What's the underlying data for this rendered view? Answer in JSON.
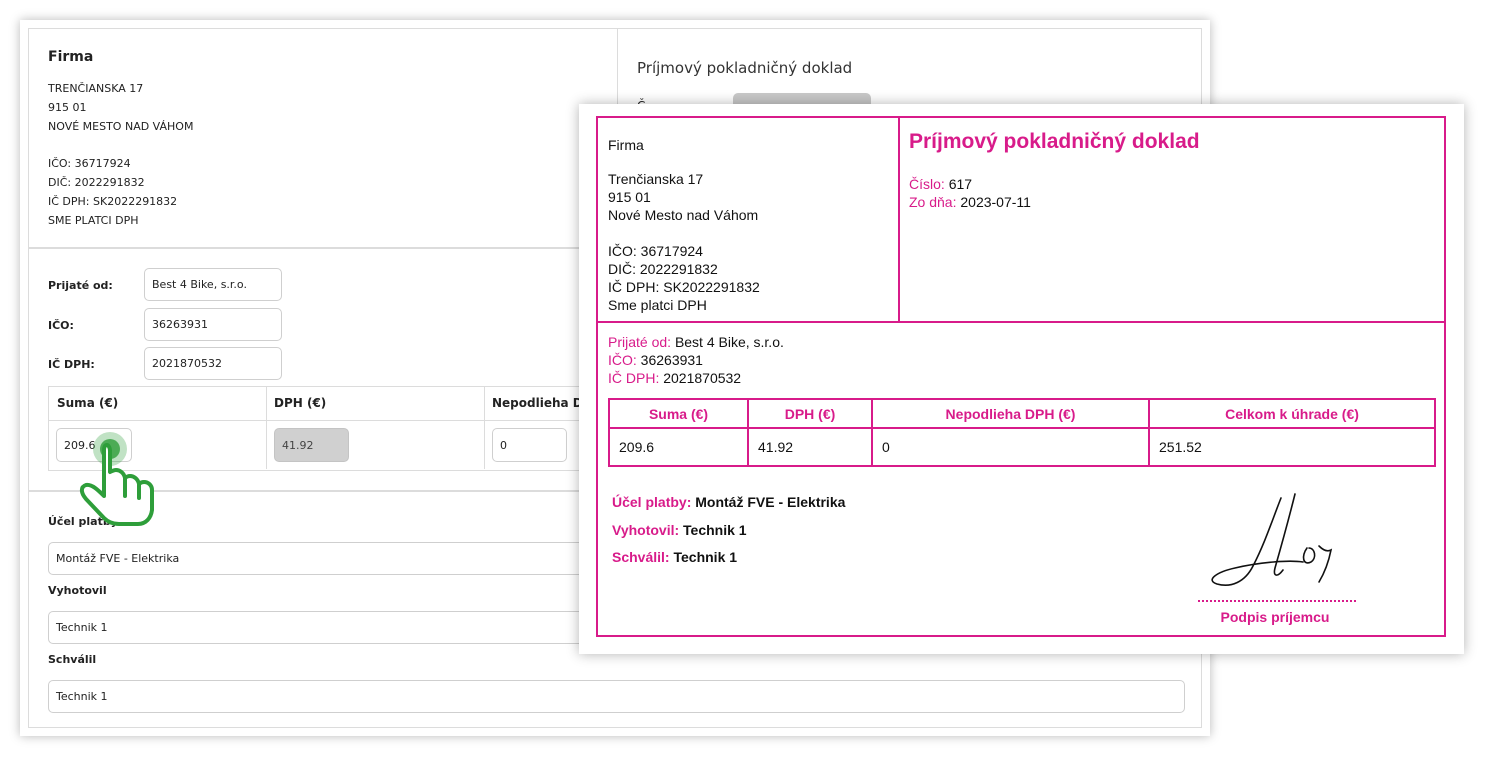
{
  "form": {
    "company": {
      "name": "Firma",
      "street": "TRENČIANSKA 17",
      "zip": "915 01",
      "city": "NOVÉ MESTO NAD VÁHOM",
      "ico": "IČO: 36717924",
      "dic": "DIČ: 2022291832",
      "icdph": "IČ DPH: SK2022291832",
      "vat_status": "SME PLATCI DPH"
    },
    "document_type": "Príjmový pokladničný doklad",
    "number_label_partial": "Č",
    "received_from": {
      "label": "Prijaté od:",
      "value": "Best 4 Bike, s.r.o."
    },
    "ico": {
      "label": "IČO:",
      "value": "36263931"
    },
    "icdph": {
      "label": "IČ DPH:",
      "value": "2021870532"
    },
    "amounts": {
      "sum_label": "Suma (€)",
      "vat_label": "DPH (€)",
      "exempt_label": "Nepodlieha D",
      "sum_value": "209.6",
      "vat_value": "41.92",
      "exempt_value": "0"
    },
    "purpose": {
      "label": "Účel platby",
      "value": "Montáž FVE - Elektrika"
    },
    "prepared_by": {
      "label": "Vyhotovil",
      "value": "Technik 1"
    },
    "approved_by": {
      "label": "Schválil",
      "value": "Technik 1"
    }
  },
  "receipt": {
    "company": {
      "name": "Firma",
      "street": "Trenčianska 17",
      "zip": "915 01",
      "city": "Nové Mesto nad Váhom",
      "ico": "IČO: 36717924",
      "dic": "DIČ: 2022291832",
      "icdph": "IČ DPH: SK2022291832",
      "vat_status": "Sme platci DPH"
    },
    "title": "Príjmový pokladničný doklad",
    "number_label": "Číslo:",
    "number_value": "617",
    "date_label": "Zo dňa:",
    "date_value": "2023-07-11",
    "received_from_label": "Prijaté od:",
    "received_from_value": "Best 4 Bike, s.r.o.",
    "ico_label": "IČO:",
    "ico_value": "36263931",
    "icdph_label": "IČ DPH:",
    "icdph_value": "2021870532",
    "table": {
      "headers": [
        "Suma (€)",
        "DPH (€)",
        "Nepodlieha DPH (€)",
        "Celkom k úhrade (€)"
      ],
      "row": [
        "209.6",
        "41.92",
        "0",
        "251.52"
      ]
    },
    "purpose_label": "Účel platby:",
    "purpose_value": "Montáž FVE - Elektrika",
    "prepared_label": "Vyhotovil:",
    "prepared_value": "Technik 1",
    "approved_label": "Schválil:",
    "approved_value": "Technik 1",
    "signature_label": "Podpis príjemcu"
  },
  "colors": {
    "accent": "#d81b8a",
    "cursor": "#2e9e3a"
  },
  "icons": {
    "cursor": "pointing-hand-icon"
  }
}
